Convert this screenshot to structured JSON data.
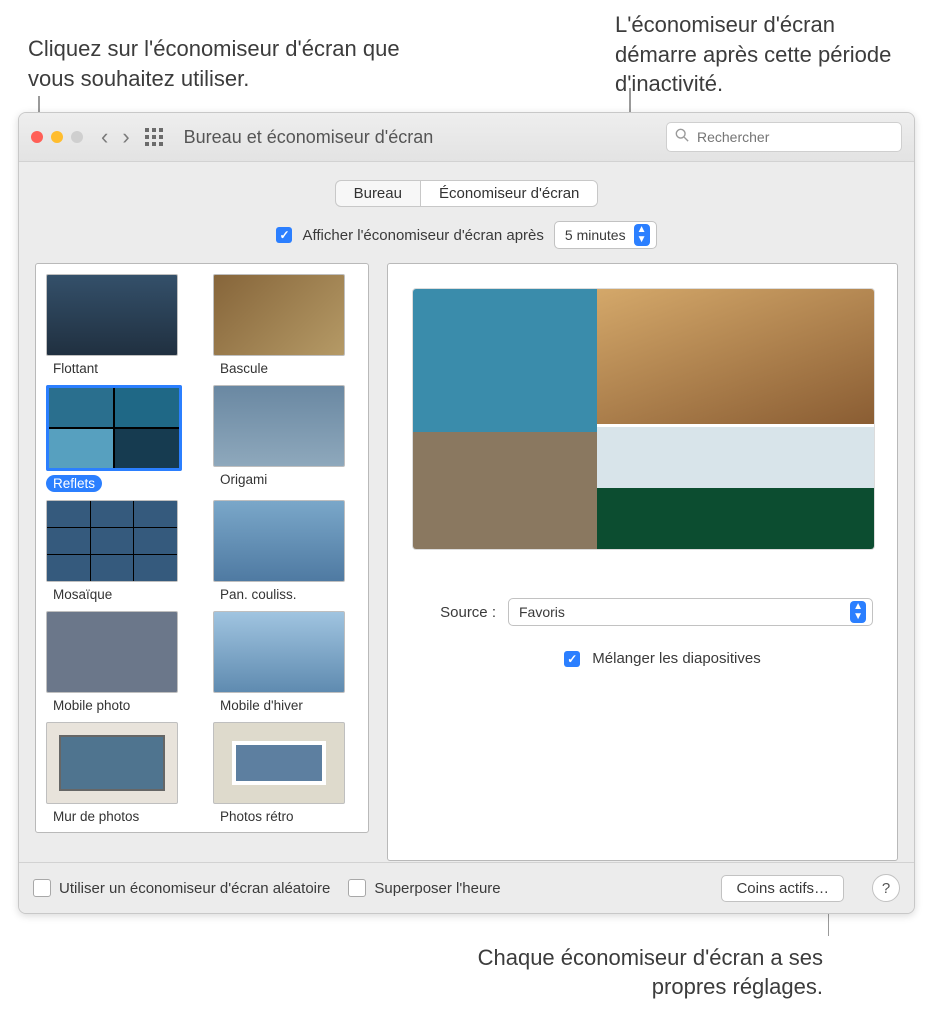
{
  "callouts": {
    "left": "Cliquez sur l'économiseur d'écran que vous souhaitez utiliser.",
    "right": "L'économiseur d'écran démarre après cette période d'inactivité.",
    "bottom": "Chaque économiseur d'écran a ses propres réglages."
  },
  "window": {
    "title": "Bureau et économiseur d'écran",
    "search_placeholder": "Rechercher",
    "tabs": {
      "desktop": "Bureau",
      "screensaver": "Économiseur d'écran"
    },
    "show_after": {
      "checkbox_checked": true,
      "label": "Afficher l'économiseur d'écran après",
      "value": "5 minutes"
    },
    "savers": [
      {
        "name": "Flottant",
        "thumb": "t1",
        "selected": false
      },
      {
        "name": "Bascule",
        "thumb": "t2",
        "selected": false
      },
      {
        "name": "Reflets",
        "thumb": "t3",
        "selected": true
      },
      {
        "name": "Origami",
        "thumb": "t4",
        "selected": false
      },
      {
        "name": "Mosaïque",
        "thumb": "t5",
        "selected": false
      },
      {
        "name": "Pan. couliss.",
        "thumb": "t6",
        "selected": false
      },
      {
        "name": "Mobile photo",
        "thumb": "t7",
        "selected": false
      },
      {
        "name": "Mobile d'hiver",
        "thumb": "t8",
        "selected": false
      },
      {
        "name": "Mur de photos",
        "thumb": "t9",
        "selected": false
      },
      {
        "name": "Photos rétro",
        "thumb": "t10",
        "selected": false
      }
    ],
    "options": {
      "source_label": "Source :",
      "source_value": "Favoris",
      "shuffle_checked": true,
      "shuffle_label": "Mélanger les diapositives"
    },
    "footer": {
      "random_label": "Utiliser un économiseur d'écran aléatoire",
      "random_checked": false,
      "clock_label": "Superposer l'heure",
      "clock_checked": false,
      "hotcorners_label": "Coins actifs…"
    }
  }
}
